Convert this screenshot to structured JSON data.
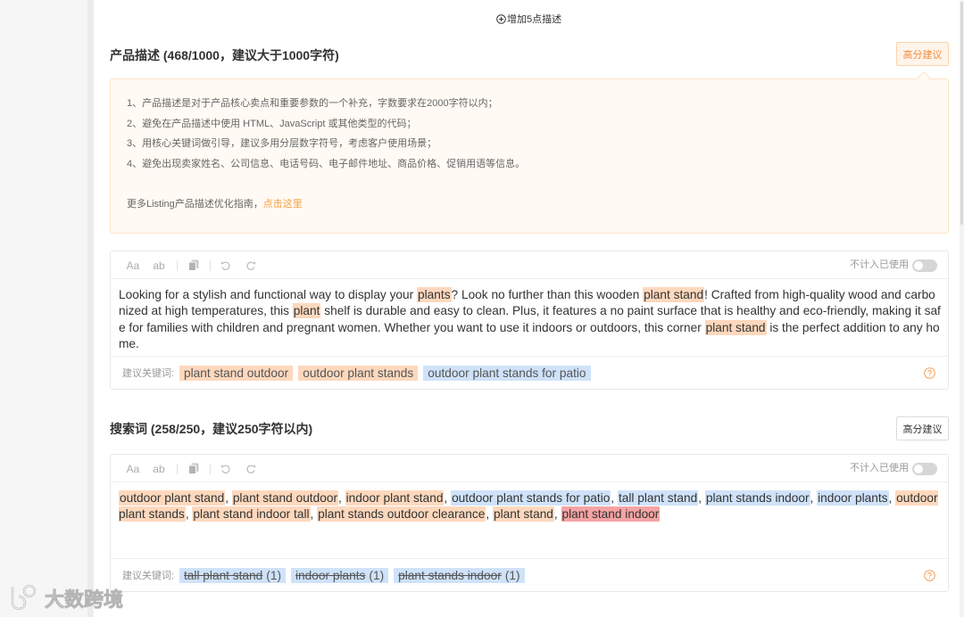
{
  "add_points": {
    "icon": "plus-circle-icon",
    "label": "增加5点描述"
  },
  "toolbar": {
    "case_label": "Aa",
    "lower_label": "ab",
    "copy_icon": "copy-icon",
    "undo_icon": "undo-icon",
    "redo_icon": "redo-icon"
  },
  "help_icon": "question-circle-icon",
  "colors": {
    "accent": "#f28c3c",
    "link": "#f5a042",
    "tip_background": "#fffaf3",
    "highlight_orange": "#fdd8bd",
    "highlight_blue": "#cfe2f9",
    "highlight_red": "#f5a3a3"
  },
  "description": {
    "title": "产品描述 (468/1000，建议大于1000字符)",
    "score_button": "高分建议",
    "score_button_active": true,
    "tips": [
      "1、产品描述是对于产品核心卖点和重要参数的一个补充，字数要求在2000字符以内；",
      "2、避免在产品描述中使用 HTML、JavaScript 或其他类型的代码；",
      "3、用核心关键词做引导，建议多用分层数字符号，考虑客户使用场景；",
      "4、避免出现卖家姓名、公司信息、电话号码、电子邮件地址、商品价格、促销用语等信息。"
    ],
    "guide_text": "更多Listing产品描述优化指南，",
    "guide_link": "点击这里",
    "editor": {
      "exclude_label": "不计入已使用",
      "exclude_on": false,
      "segments": [
        {
          "text": "Looking for a stylish and functional way to display your ",
          "bg": null
        },
        {
          "text": "plants",
          "bg": "#fdd8bd"
        },
        {
          "text": "? Look no further than this wooden ",
          "bg": null
        },
        {
          "text": "plant stand",
          "bg": "#fdd8bd"
        },
        {
          "text": "! Crafted from high-quality wood and carbonized at high temperatures, this ",
          "bg": null
        },
        {
          "text": "plant",
          "bg": "#fdd8bd"
        },
        {
          "text": " shelf is durable and easy to clean. Plus, it features a no paint surface that is healthy and eco-friendly, making it safe for families with children and pregnant women. Whether you want to use it indoors or outdoors, this corner ",
          "bg": null
        },
        {
          "text": "plant stand",
          "bg": "#fdd8bd"
        },
        {
          "text": " is the perfect addition to any home.",
          "bg": null
        }
      ],
      "keywords_label": "建议关键词:",
      "keywords": [
        {
          "text": "plant stand outdoor",
          "bg": "#fdd8bd",
          "struck": false
        },
        {
          "text": "outdoor plant stands",
          "bg": "#fdd8bd",
          "struck": false
        },
        {
          "text": "outdoor plant stands for patio",
          "bg": "#cfe2f9",
          "struck": false
        }
      ]
    }
  },
  "search_terms": {
    "title": "搜索词 (258/250，建议250字符以内)",
    "score_button": "高分建议",
    "score_button_active": false,
    "editor": {
      "exclude_label": "不计入已使用",
      "exclude_on": false,
      "segments": [
        {
          "text": "outdoor plant stand",
          "bg": "#fdd8bd"
        },
        {
          "text": ", ",
          "bg": null
        },
        {
          "text": "plant stand outdoor",
          "bg": "#fdd8bd"
        },
        {
          "text": ", ",
          "bg": null
        },
        {
          "text": "indoor plant stand",
          "bg": "#fdd8bd"
        },
        {
          "text": ", ",
          "bg": null
        },
        {
          "text": "outdoor plant stands for patio",
          "bg": "#cfe2f9"
        },
        {
          "text": ", ",
          "bg": null
        },
        {
          "text": "tall plant stand",
          "bg": "#cfe2f9"
        },
        {
          "text": ", ",
          "bg": null
        },
        {
          "text": "plant stands indoor",
          "bg": "#cfe2f9"
        },
        {
          "text": ", ",
          "bg": null
        },
        {
          "text": "indoor plants",
          "bg": "#cfe2f9"
        },
        {
          "text": ", ",
          "bg": null
        },
        {
          "text": "outdoor plant stands",
          "bg": "#fdd8bd"
        },
        {
          "text": ", ",
          "bg": null
        },
        {
          "text": "plant stand indoor tall",
          "bg": "#fdd8bd"
        },
        {
          "text": ", ",
          "bg": null
        },
        {
          "text": "plant stands outdoor clearance",
          "bg": "#fdd8bd"
        },
        {
          "text": ", ",
          "bg": null
        },
        {
          "text": "plant stand",
          "bg": "#fdd8bd"
        },
        {
          "text": ", ",
          "bg": null
        },
        {
          "text": "plant stand indoor",
          "bg": "#f5a3a3"
        }
      ],
      "keywords_label": "建议关键词:",
      "keywords": [
        {
          "text": "tall plant stand",
          "count": "(1)",
          "bg": "#cfe2f9",
          "struck": true
        },
        {
          "text": "indoor plants",
          "count": "(1)",
          "bg": "#cfe2f9",
          "struck": true
        },
        {
          "text": "plant stands indoor",
          "count": "(1)",
          "bg": "#cfe2f9",
          "struck": true
        }
      ]
    }
  },
  "watermark": "大数跨境"
}
